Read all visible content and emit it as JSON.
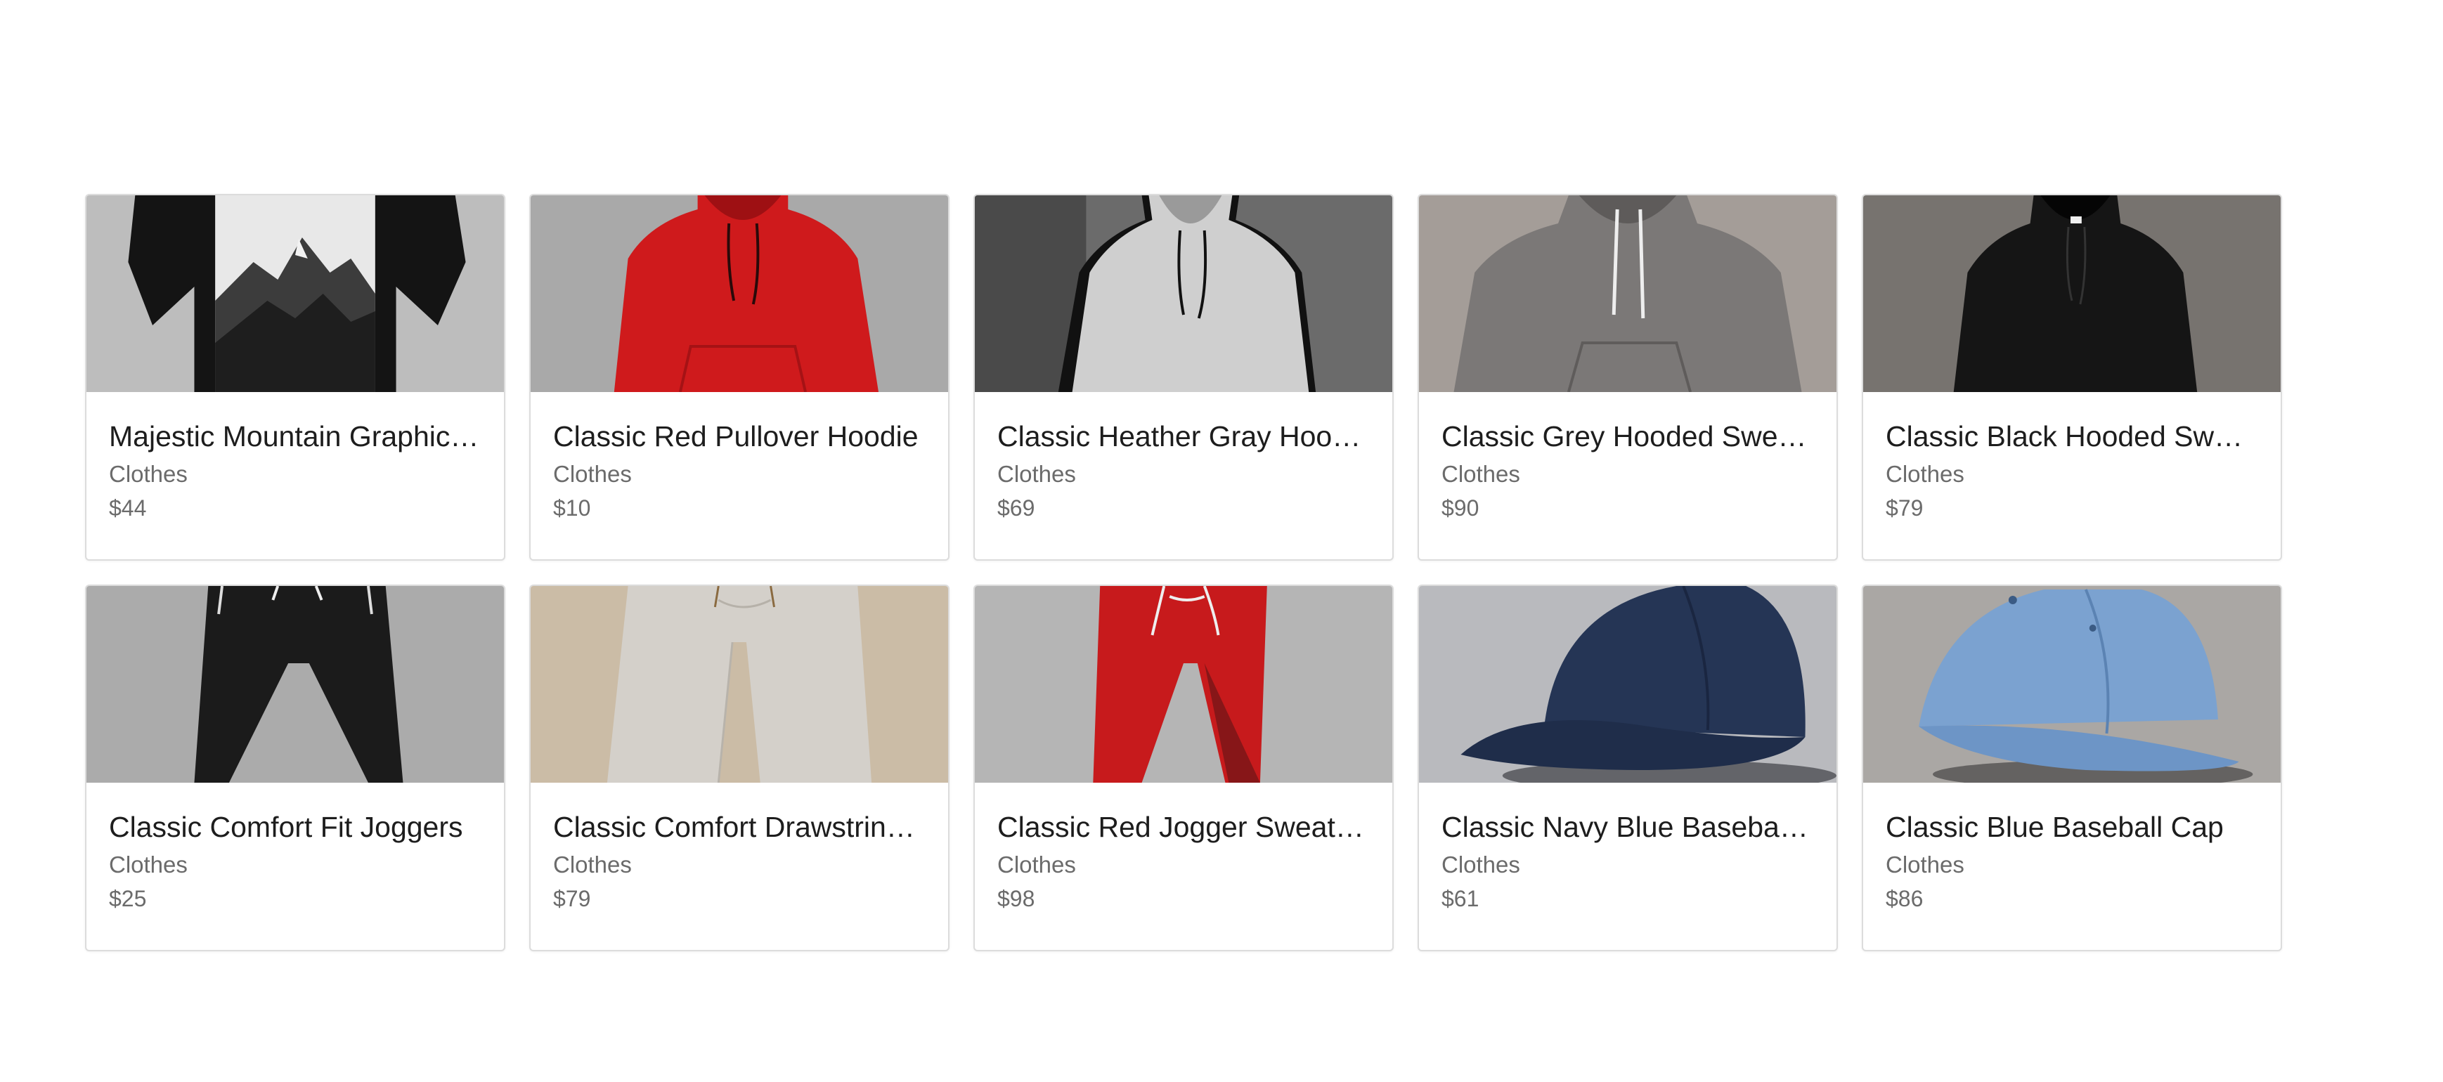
{
  "products": [
    {
      "title": "Majestic Mountain Graphic Tee",
      "category": "Clothes",
      "price": "$44",
      "image": "black-graphic-tshirt-image",
      "bg": "#b9b9b9"
    },
    {
      "title": "Classic Red Pullover Hoodie",
      "category": "Clothes",
      "price": "$10",
      "image": "red-hoodie-image",
      "bg": "#a8a8a8"
    },
    {
      "title": "Classic Heather Gray Hoodie",
      "category": "Clothes",
      "price": "$69",
      "image": "gray-hoodie-image",
      "bg": "#6f6f6f"
    },
    {
      "title": "Classic Grey Hooded Sweatshirt",
      "category": "Clothes",
      "price": "$90",
      "image": "grey-hooded-sweatshirt-image",
      "bg": "#a39c97"
    },
    {
      "title": "Classic Black Hooded Sweatshirt",
      "category": "Clothes",
      "price": "$79",
      "image": "black-hooded-sweatshirt-image",
      "bg": "#7a7672"
    },
    {
      "title": "Classic Comfort Fit Joggers",
      "category": "Clothes",
      "price": "$25",
      "image": "black-joggers-image",
      "bg": "#a9a9a9"
    },
    {
      "title": "Classic Comfort Drawstring Joggers",
      "category": "Clothes",
      "price": "$79",
      "image": "beige-joggers-image",
      "bg": "#cdbfa9"
    },
    {
      "title": "Classic Red Jogger Sweatpants",
      "category": "Clothes",
      "price": "$98",
      "image": "red-joggers-image",
      "bg": "#b4b4b4"
    },
    {
      "title": "Classic Navy Blue Baseball Cap",
      "category": "Clothes",
      "price": "$61",
      "image": "navy-cap-image",
      "bg": "#b8b9bd"
    },
    {
      "title": "Classic Blue Baseball Cap",
      "category": "Clothes",
      "price": "$86",
      "image": "blue-cap-image",
      "bg": "#aaa7a4"
    }
  ]
}
